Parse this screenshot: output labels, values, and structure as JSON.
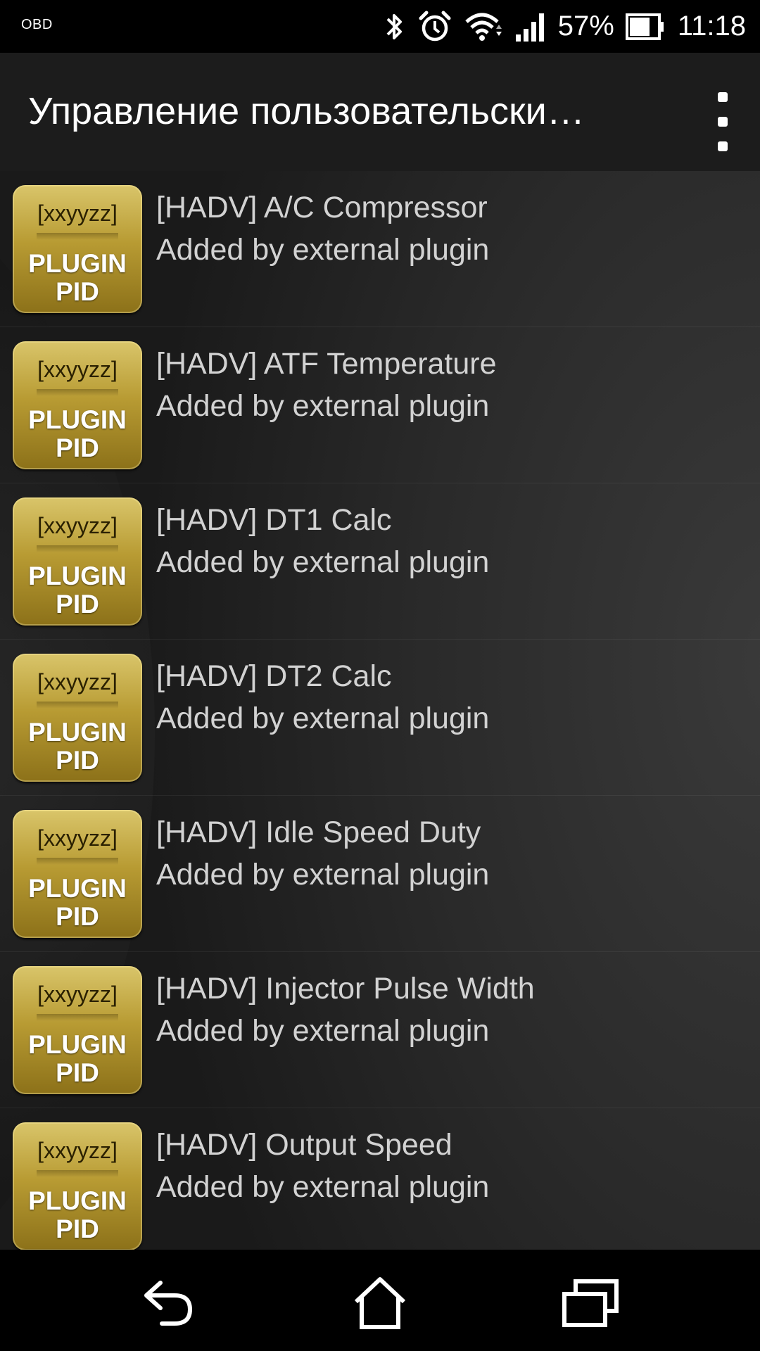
{
  "status_bar": {
    "carrier": "OBD",
    "battery_percent": "57%",
    "time": "11:18",
    "icons": [
      "bluetooth-icon",
      "alarm-icon",
      "wifi-icon",
      "signal-icon",
      "battery-icon"
    ]
  },
  "app_bar": {
    "title": "Управление пользовательски…",
    "overflow_icon": "more-vert-icon"
  },
  "list": {
    "items": [
      {
        "badge_code": "[xxyyzz]",
        "badge_line1": "PLUGIN",
        "badge_line2": "PID",
        "title": "[HADV] A/C Compressor",
        "subtitle": "Added by external plugin"
      },
      {
        "badge_code": "[xxyyzz]",
        "badge_line1": "PLUGIN",
        "badge_line2": "PID",
        "title": "[HADV] ATF Temperature",
        "subtitle": "Added by external plugin"
      },
      {
        "badge_code": "[xxyyzz]",
        "badge_line1": "PLUGIN",
        "badge_line2": "PID",
        "title": "[HADV] DT1 Calc",
        "subtitle": "Added by external plugin"
      },
      {
        "badge_code": "[xxyyzz]",
        "badge_line1": "PLUGIN",
        "badge_line2": "PID",
        "title": "[HADV] DT2 Calc",
        "subtitle": "Added by external plugin"
      },
      {
        "badge_code": "[xxyyzz]",
        "badge_line1": "PLUGIN",
        "badge_line2": "PID",
        "title": "[HADV] Idle Speed Duty",
        "subtitle": "Added by external plugin"
      },
      {
        "badge_code": "[xxyyzz]",
        "badge_line1": "PLUGIN",
        "badge_line2": "PID",
        "title": "[HADV] Injector Pulse Width",
        "subtitle": "Added by external plugin"
      },
      {
        "badge_code": "[xxyyzz]",
        "badge_line1": "PLUGIN",
        "badge_line2": "PID",
        "title": "[HADV] Output Speed",
        "subtitle": "Added by external plugin"
      }
    ]
  },
  "nav_bar": {
    "icons": [
      "back-icon",
      "home-icon",
      "recents-icon"
    ]
  },
  "colors": {
    "badge_gold": "#b89b33",
    "app_bar_bg": "#1c1c1c",
    "text": "#d2d2d2"
  }
}
